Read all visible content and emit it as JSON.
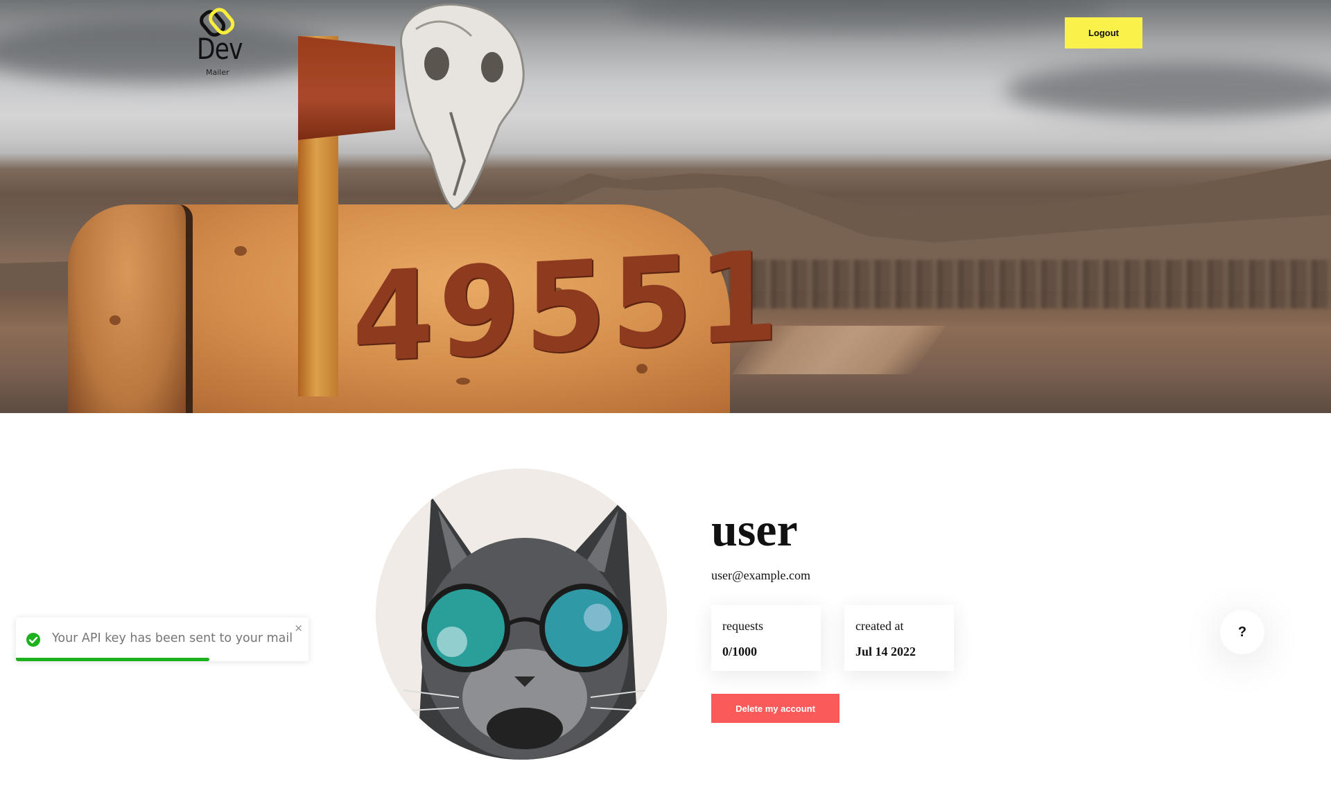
{
  "header": {
    "logo_title": "Dev",
    "logo_subtitle": "Mailer",
    "hero_mailbox_number": "49551",
    "logout_label": "Logout"
  },
  "profile": {
    "username": "user",
    "email": "user@example.com",
    "stats": [
      {
        "label": "requests",
        "value": "0/1000"
      },
      {
        "label": "created at",
        "value": "Jul 14 2022"
      }
    ],
    "delete_label": "Delete my account"
  },
  "help": {
    "label": "?"
  },
  "toast": {
    "message": "Your API key has been sent to your mail",
    "close_label": "×",
    "progress": 0.66,
    "status_color": "#1db11d"
  },
  "colors": {
    "logout_bg": "#fbf14b",
    "delete_bg": "#fb5a5a"
  },
  "icons": {
    "toast_status": "check-circle-icon",
    "logo": "logo-mark-icon"
  }
}
